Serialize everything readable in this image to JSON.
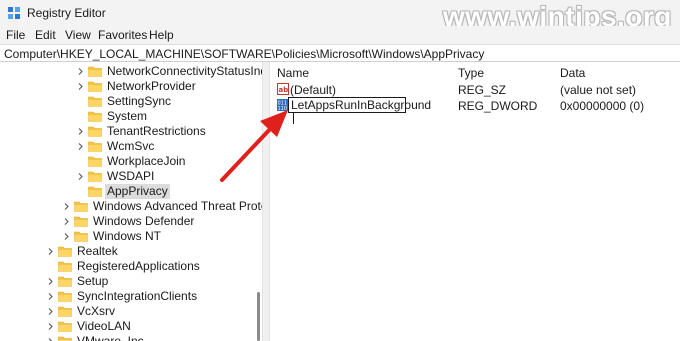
{
  "window": {
    "title": "Registry Editor",
    "watermark": "www.wintips.org",
    "icon": "registry-editor-icon"
  },
  "menu": [
    "File",
    "Edit",
    "View",
    "Favorites",
    "Help"
  ],
  "address": "Computer\\HKEY_LOCAL_MACHINE\\SOFTWARE\\Policies\\Microsoft\\Windows\\AppPrivacy",
  "tree": [
    {
      "label": "NetworkConnectivityStatusIndi",
      "level": 2,
      "expandable": true
    },
    {
      "label": "NetworkProvider",
      "level": 2,
      "expandable": true
    },
    {
      "label": "SettingSync",
      "level": 2,
      "expandable": false
    },
    {
      "label": "System",
      "level": 2,
      "expandable": false
    },
    {
      "label": "TenantRestrictions",
      "level": 2,
      "expandable": true
    },
    {
      "label": "WcmSvc",
      "level": 2,
      "expandable": true
    },
    {
      "label": "WorkplaceJoin",
      "level": 2,
      "expandable": false
    },
    {
      "label": "WSDAPI",
      "level": 2,
      "expandable": true
    },
    {
      "label": "AppPrivacy",
      "level": 2,
      "expandable": false,
      "selected": true
    },
    {
      "label": "Windows Advanced Threat Protec",
      "level": 1,
      "expandable": true
    },
    {
      "label": "Windows Defender",
      "level": 1,
      "expandable": true
    },
    {
      "label": "Windows NT",
      "level": 1,
      "expandable": true
    },
    {
      "label": "Realtek",
      "level": 0,
      "expandable": true
    },
    {
      "label": "RegisteredApplications",
      "level": 0,
      "expandable": false
    },
    {
      "label": "Setup",
      "level": 0,
      "expandable": true
    },
    {
      "label": "SyncIntegrationClients",
      "level": 0,
      "expandable": true
    },
    {
      "label": "VcXsrv",
      "level": 0,
      "expandable": true
    },
    {
      "label": "VideoLAN",
      "level": 0,
      "expandable": true
    },
    {
      "label": "VMware, Inc.",
      "level": 0,
      "expandable": true
    }
  ],
  "values": {
    "headers": {
      "name": "Name",
      "type": "Type",
      "data": "Data"
    },
    "rows": [
      {
        "name": "(Default)",
        "type": "REG_SZ",
        "data": "(value not set)",
        "icon": "string-value-icon",
        "editing": false
      },
      {
        "name": "LetAppsRunInBackground",
        "type": "REG_DWORD",
        "data": "0x00000000 (0)",
        "icon": "dword-value-icon",
        "editing": true
      }
    ]
  },
  "colors": {
    "folder": "#f5c542",
    "arrow": "#e0201b",
    "selection": "#dcdcdc"
  }
}
